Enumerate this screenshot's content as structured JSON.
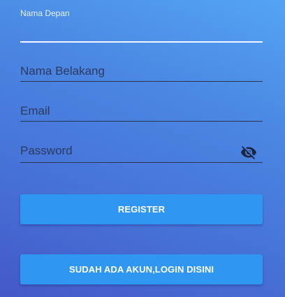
{
  "form": {
    "first_name": {
      "label": "Nama Depan",
      "value": ""
    },
    "last_name": {
      "placeholder": "Nama Belakang"
    },
    "email": {
      "placeholder": "Email"
    },
    "password": {
      "placeholder": "Password",
      "visibility_icon": "visibility-off-icon"
    }
  },
  "buttons": {
    "register_label": "REGISTER",
    "login_label": "SUDAH ADA AKUN,LOGIN DISINI"
  },
  "colors": {
    "button": "#2f97f2",
    "background_top": "#54a4f4",
    "background_bottom": "#4458c6",
    "active_underline": "#f2f6ff"
  }
}
